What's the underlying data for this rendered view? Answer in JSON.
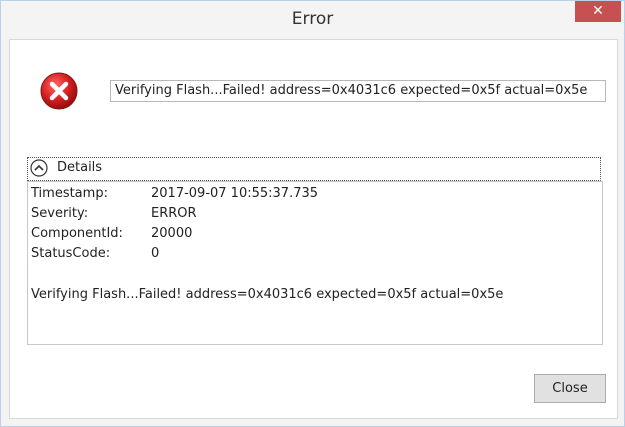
{
  "window": {
    "title": "Error",
    "close_glyph": "✕",
    "accent_close": "#c75050"
  },
  "message": {
    "text": "Verifying Flash...Failed! address=0x4031c6 expected=0x5f actual=0x5e",
    "icon": "error-icon"
  },
  "details": {
    "header_label": "Details",
    "rows": [
      {
        "key": "Timestamp:",
        "value": "2017-09-07 10:55:37.735"
      },
      {
        "key": "Severity:",
        "value": "ERROR"
      },
      {
        "key": "ComponentId:",
        "value": "20000"
      },
      {
        "key": "StatusCode:",
        "value": "0"
      }
    ],
    "full_message": "Verifying Flash...Failed! address=0x4031c6 expected=0x5f actual=0x5e"
  },
  "buttons": {
    "close_label": "Close"
  }
}
